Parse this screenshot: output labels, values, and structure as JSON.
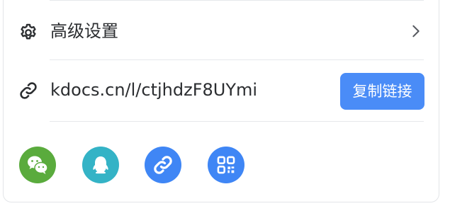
{
  "advanced_settings": {
    "label": "高级设置",
    "icon": "gear-icon"
  },
  "share_link": {
    "url": "kdocs.cn/l/ctjhdzF8UYmi",
    "icon": "link-icon",
    "copy_button_label": "复制链接"
  },
  "share_channels": [
    {
      "name": "wechat",
      "icon": "wechat-icon",
      "color": "#5aab3d"
    },
    {
      "name": "qq",
      "icon": "qq-penguin-icon",
      "color": "#34b3c6"
    },
    {
      "name": "link",
      "icon": "link-icon",
      "color": "#3f86f5"
    },
    {
      "name": "qrcode",
      "icon": "qrcode-icon",
      "color": "#3f86f5"
    }
  ],
  "colors": {
    "accent": "#3f86f5",
    "button": "#4a8cf7",
    "text": "#2b2d30",
    "divider": "#e6e8eb"
  }
}
